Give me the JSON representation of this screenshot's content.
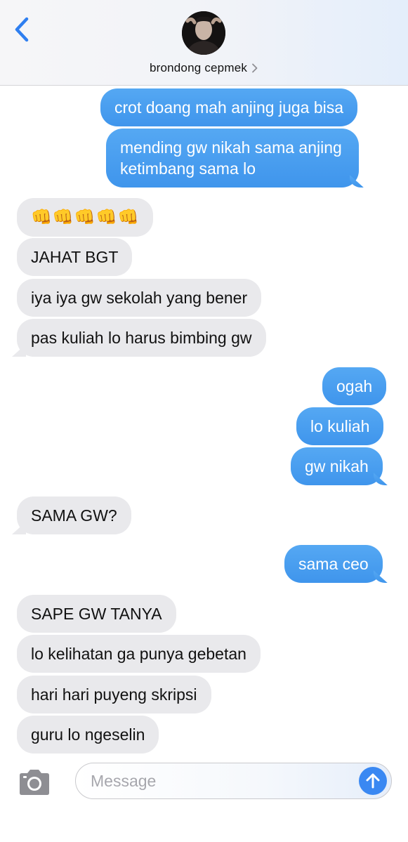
{
  "header": {
    "contact_name": "brondong cepmek",
    "back_icon": "chevron-left-icon",
    "avatar_icon": "avatar",
    "accent_color": "#2f7ff0"
  },
  "messages": [
    {
      "from": "me",
      "text": "crot doang mah anjing juga bisa"
    },
    {
      "from": "me",
      "text": "mending gw nikah sama anjing",
      "text2": "ketimbang sama lo"
    },
    {
      "from": "them",
      "text": "👊👊👊👊👊"
    },
    {
      "from": "them",
      "text": "JAHAT BGT"
    },
    {
      "from": "them",
      "text": "iya iya gw sekolah yang bener"
    },
    {
      "from": "them",
      "text": "pas kuliah lo harus bimbing gw"
    },
    {
      "from": "me",
      "text": "ogah"
    },
    {
      "from": "me",
      "text": "lo kuliah"
    },
    {
      "from": "me",
      "text": "gw nikah"
    },
    {
      "from": "them",
      "text": "SAMA GW?"
    },
    {
      "from": "me",
      "text": "sama ceo"
    },
    {
      "from": "them",
      "text": "SAPE GW TANYA"
    },
    {
      "from": "them",
      "text": "lo kelihatan ga punya gebetan"
    },
    {
      "from": "them",
      "text": "hari hari puyeng skripsi"
    },
    {
      "from": "them",
      "text": "guru lo ngeselin"
    }
  ],
  "composer": {
    "placeholder": "Message",
    "camera_icon": "camera-icon",
    "send_icon": "arrow-up-icon"
  },
  "colors": {
    "sent_bubble": "#4a9ff0",
    "received_bubble": "#e9e9ec",
    "send_button": "#3a88f2"
  }
}
